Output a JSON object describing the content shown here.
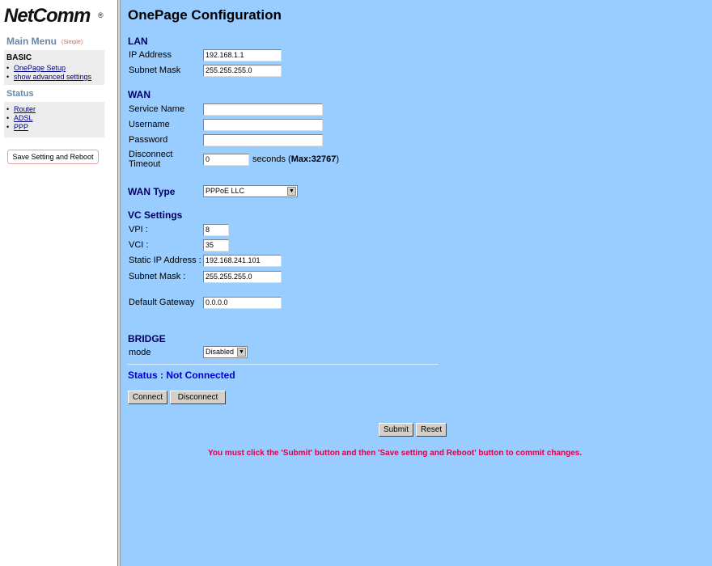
{
  "brand": {
    "logo_text": "NetComm",
    "logo_mark": "®"
  },
  "sidebar": {
    "menu_title": "Main Menu",
    "menu_mode": "(Simple)",
    "basic": {
      "title": "BASIC",
      "links": [
        {
          "label": "OnePage Setup"
        },
        {
          "label": "show advanced settings"
        }
      ]
    },
    "status": {
      "title": "Status",
      "links": [
        {
          "label": "Router"
        },
        {
          "label": "ADSL"
        },
        {
          "label": "PPP"
        }
      ]
    },
    "save_reboot_label": "Save Setting and Reboot"
  },
  "main": {
    "title": "OnePage Configuration",
    "lan": {
      "heading": "LAN",
      "ip_label": "IP Address",
      "ip_value": "192.168.1.1",
      "mask_label": "Subnet Mask",
      "mask_value": "255.255.255.0"
    },
    "wan": {
      "heading": "WAN",
      "service_label": "Service Name",
      "service_value": "",
      "username_label": "Username",
      "username_value": "",
      "password_label": "Password",
      "password_value": "",
      "disconnect_label_1": "Disconnect",
      "disconnect_label_2": "Timeout",
      "disconnect_value": "0",
      "seconds_text": "seconds (",
      "max_text": "Max:32767",
      "close_paren": ")"
    },
    "wan_type": {
      "label": "WAN Type",
      "selected": "PPPoE LLC"
    },
    "vc": {
      "heading": "VC Settings",
      "vpi_label": "VPI :",
      "vpi_value": "8",
      "vci_label": "VCI :",
      "vci_value": "35",
      "static_ip_label": "Static IP Address :",
      "static_ip_value": "192.168.241.101",
      "mask_label": "Subnet Mask :",
      "mask_value": "255.255.255.0",
      "gateway_label": "Default Gateway",
      "gateway_value": "0.0.0.0"
    },
    "bridge": {
      "heading": "BRIDGE",
      "mode_label": "mode",
      "mode_selected": "Disabled"
    },
    "status_text": "Status : Not Connected",
    "connect_label": "Connect",
    "disconnect_label": "Disconnect",
    "submit_label": "Submit",
    "reset_label": "Reset",
    "notice": "You must click the 'Submit' button and then 'Save setting and Reboot' button to commit changes."
  },
  "colors": {
    "main_bg": "#99ccff",
    "section_heading": "#000066",
    "status_text": "#0000cc",
    "notice": "#e0004a"
  }
}
